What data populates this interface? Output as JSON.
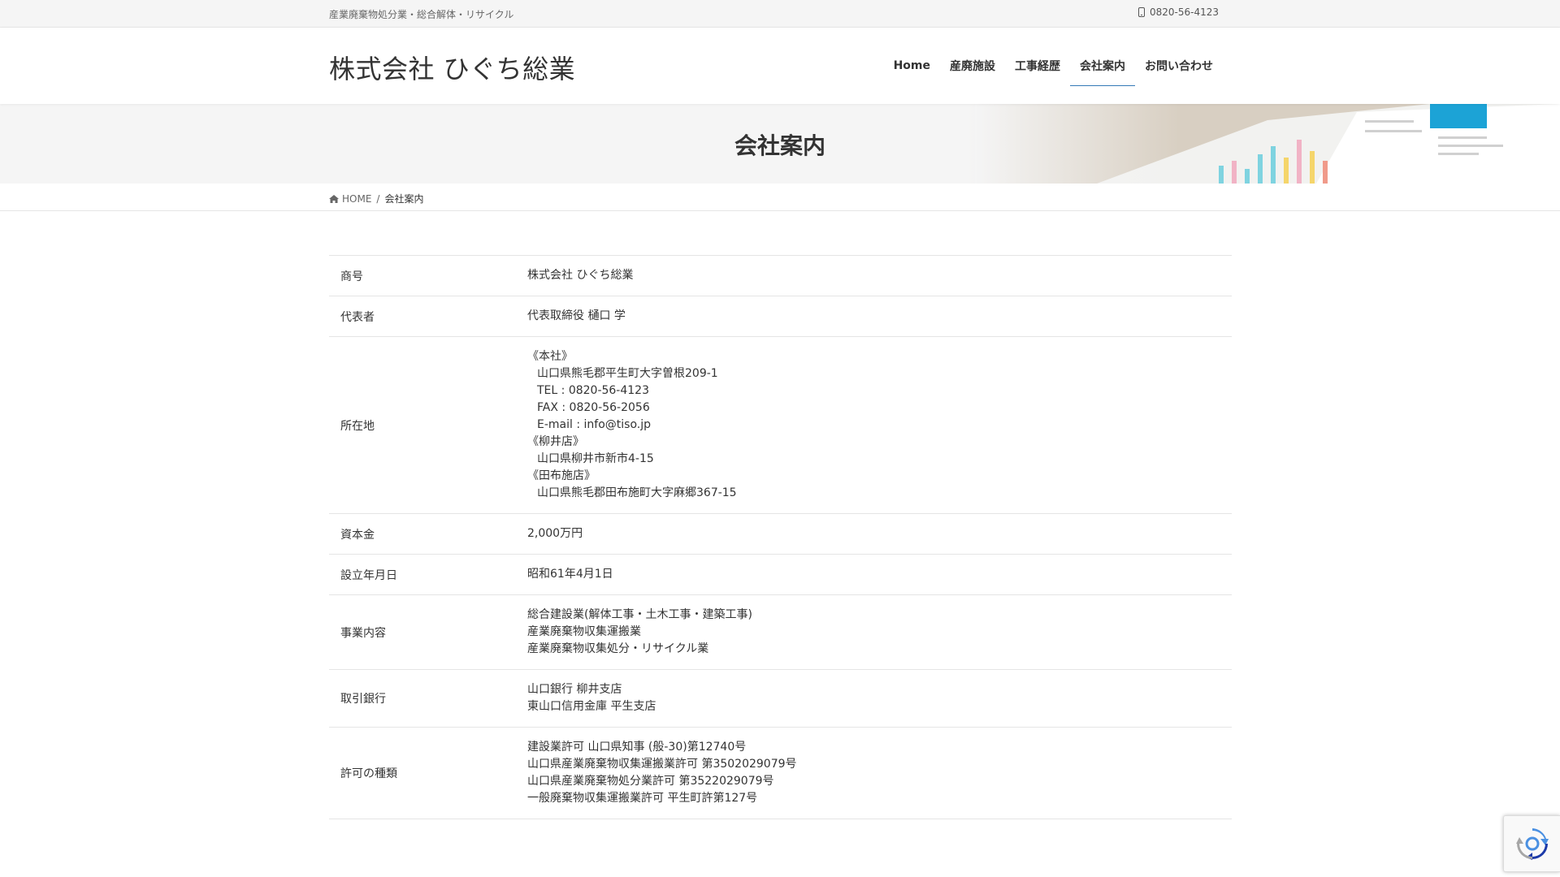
{
  "topbar": {
    "tagline": "産業廃棄物処分業・総合解体・リサイクル",
    "phone": "0820-56-4123"
  },
  "header": {
    "site_title": "株式会社 ひぐち総業",
    "nav": [
      {
        "label": "Home",
        "active": false
      },
      {
        "label": "産廃施設",
        "active": false
      },
      {
        "label": "工事経歴",
        "active": false
      },
      {
        "label": "会社案内",
        "active": true
      },
      {
        "label": "お問い合わせ",
        "active": false
      }
    ]
  },
  "banner": {
    "title": "会社案内"
  },
  "breadcrumb": {
    "home": "HOME",
    "separator": "/",
    "current": "会社案内"
  },
  "table": {
    "rows": [
      {
        "label": "商号",
        "lines": [
          "株式会社 ひぐち総業"
        ]
      },
      {
        "label": "代表者",
        "lines": [
          "代表取締役 樋口 学"
        ]
      },
      {
        "label": "所在地",
        "lines": [
          "《本社》",
          "山口県熊毛郡平生町大字曽根209-1",
          "TEL : 0820-56-4123",
          "FAX : 0820-56-2056",
          "E-mail : info@tiso.jp",
          "《柳井店》",
          "山口県柳井市新市4-15",
          "《田布施店》",
          "山口県熊毛郡田布施町大字麻郷367-15"
        ]
      },
      {
        "label": "資本金",
        "lines": [
          "2,000万円"
        ]
      },
      {
        "label": "設立年月日",
        "lines": [
          "昭和61年4月1日"
        ]
      },
      {
        "label": "事業内容",
        "lines": [
          "総合建設業(解体工事・土木工事・建築工事)",
          "産業廃棄物収集運搬業",
          "産業廃棄物収集処分・リサイクル業"
        ]
      },
      {
        "label": "取引銀行",
        "lines": [
          "山口銀行 柳井支店",
          "東山口信用金庫 平生支店"
        ]
      },
      {
        "label": "許可の種類",
        "lines": [
          "建設業許可 山口県知事 (般-30)第12740号",
          "山口県産業廃棄物収集運搬業許可 第3502029079号",
          "山口県産業廃棄物処分業許可 第3522029079号",
          "一般廃棄物収集運搬業許可 平生町許第127号"
        ]
      }
    ]
  },
  "colors": {
    "accent": "#337ab7",
    "topbar_bg": "#f5f5f5",
    "text": "#333333",
    "border": "#e5e5e5"
  },
  "icons": {
    "phone": "mobile-phone-icon",
    "home": "home-icon",
    "recaptcha": "recaptcha-logo-icon"
  }
}
